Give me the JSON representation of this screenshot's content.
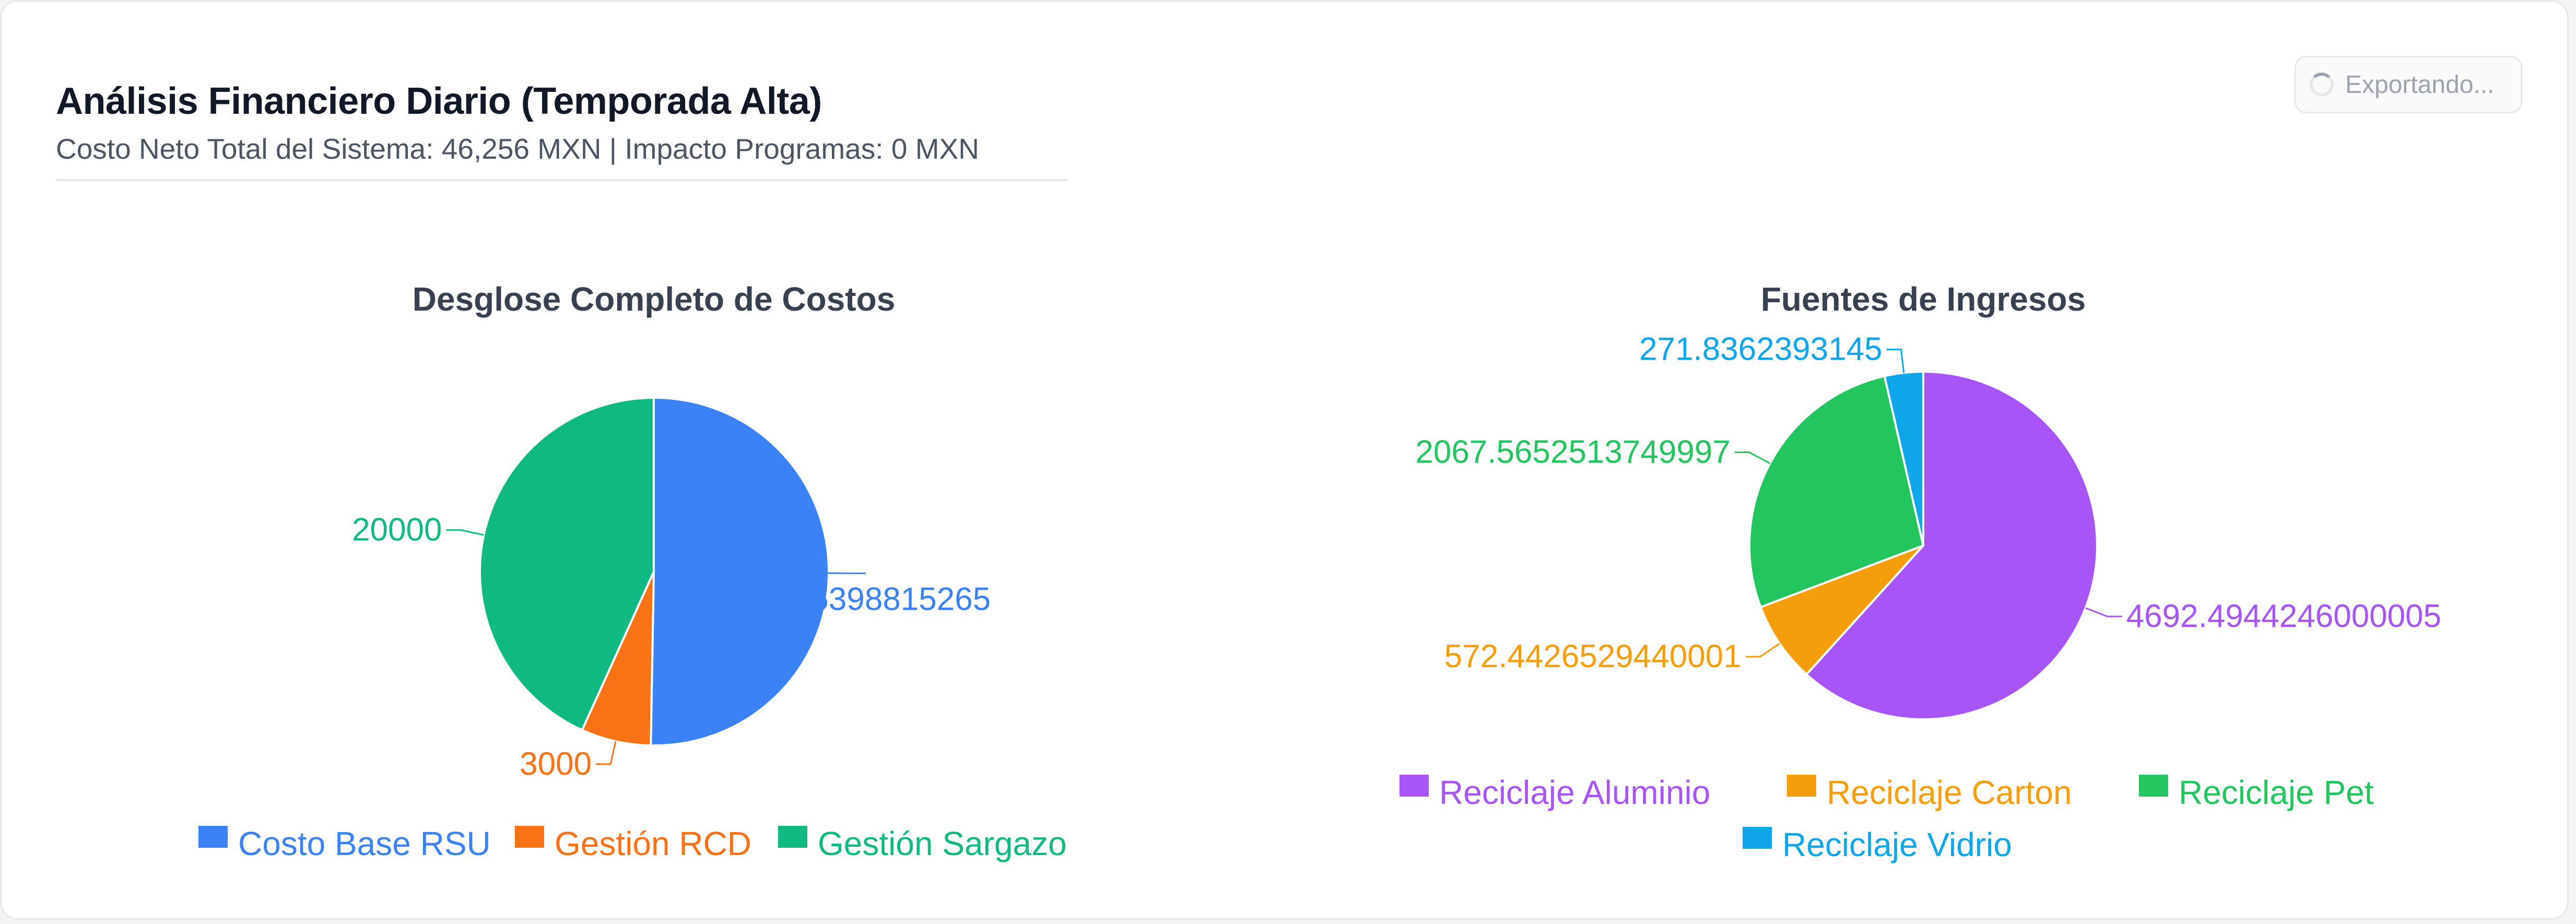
{
  "header": {
    "title": "Análisis Financiero Diario (Temporada Alta)",
    "subtitle": "Costo Neto Total del Sistema: 46,256 MXN | Impacto Programas: 0 MXN",
    "export_label": "Exportando..."
  },
  "icons": {
    "export": "loading-spinner-icon"
  },
  "chart_data": [
    {
      "type": "pie",
      "title": "Desglose Completo de Costos",
      "slices": [
        {
          "name": "Costo Base RSU",
          "value": 23255.5398815265,
          "label": "23255.5398815265",
          "color": "#3b82f6"
        },
        {
          "name": "Gestión RCD",
          "value": 3000,
          "label": "3000",
          "color": "#f97316"
        },
        {
          "name": "Gestión Sargazo",
          "value": 20000,
          "label": "20000",
          "color": "#10b981"
        }
      ],
      "legend_position": "bottom"
    },
    {
      "type": "pie",
      "title": "Fuentes de Ingresos",
      "slices": [
        {
          "name": "Reciclaje Aluminio",
          "value": 4692.494424600001,
          "label": "4692.4944246000005",
          "color": "#a855f7"
        },
        {
          "name": "Reciclaje Carton",
          "value": 572.4426529440001,
          "label": "572.4426529440001",
          "color": "#f59e0b"
        },
        {
          "name": "Reciclaje Pet",
          "value": 2067.5652513749997,
          "label": "2067.5652513749997",
          "color": "#22c55e"
        },
        {
          "name": "Reciclaje Vidrio",
          "value": 271.8362393145,
          "label": "271.8362393145",
          "color": "#0ea5e9"
        }
      ],
      "legend_position": "bottom"
    }
  ]
}
